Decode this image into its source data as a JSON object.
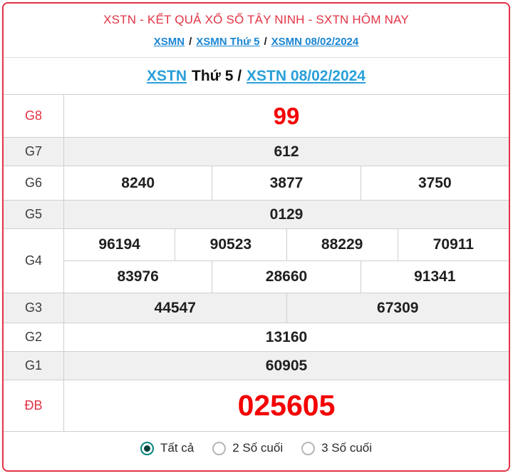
{
  "header": {
    "title": "XSTN - KẾT QUẢ XỔ SỐ TÂY NINH - SXTN HÔM NAY",
    "breadcrumb": {
      "links": [
        "XSMN",
        "XSMN Thứ 5",
        "XSMN 08/02/2024"
      ],
      "separator": "/"
    }
  },
  "subheader": {
    "link1": "XSTN",
    "middle": "Thứ 5 /",
    "link2": "XSTN 08/02/2024"
  },
  "results": {
    "rows": [
      {
        "label": "G8",
        "cells": [
          [
            "99"
          ]
        ]
      },
      {
        "label": "G7",
        "cells": [
          [
            "612"
          ]
        ]
      },
      {
        "label": "G6",
        "cells": [
          [
            "8240",
            "3877",
            "3750"
          ]
        ]
      },
      {
        "label": "G5",
        "cells": [
          [
            "0129"
          ]
        ]
      },
      {
        "label": "G4",
        "cells": [
          [
            "96194",
            "90523",
            "88229",
            "70911"
          ],
          [
            "83976",
            "28660",
            "91341"
          ]
        ]
      },
      {
        "label": "G3",
        "cells": [
          [
            "44547",
            "67309"
          ]
        ]
      },
      {
        "label": "G2",
        "cells": [
          [
            "13160"
          ]
        ]
      },
      {
        "label": "G1",
        "cells": [
          [
            "60905"
          ]
        ]
      },
      {
        "label": "ĐB",
        "cells": [
          [
            "025605"
          ]
        ]
      }
    ]
  },
  "filter": {
    "options": [
      {
        "label": "Tất cả",
        "selected": true
      },
      {
        "label": "2 Số cuối",
        "selected": false
      },
      {
        "label": "3 Số cuối",
        "selected": false
      }
    ]
  },
  "colors": {
    "accent_red": "#e23345",
    "result_red": "#f40000",
    "breadcrumb_link_blue": "#1b86d3",
    "subheader_link_blue": "#2aa0d8",
    "row_alt_gray": "#f0f0f0",
    "radio_teal": "#00857a"
  }
}
